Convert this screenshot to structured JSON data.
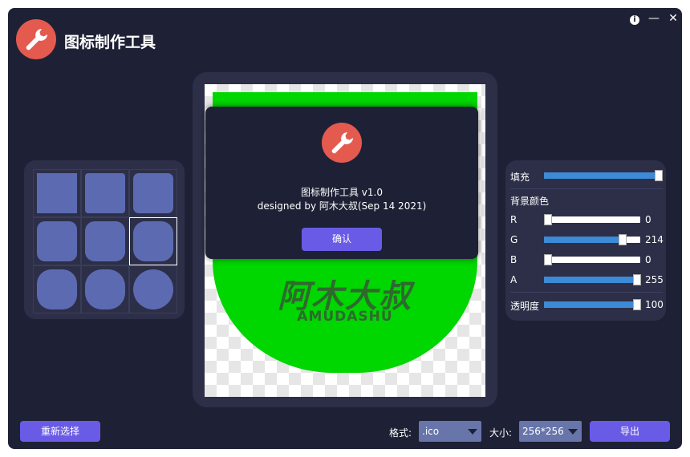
{
  "app": {
    "title": "图标制作工具",
    "logo_icon": "wrench-icon",
    "logo_color": "#e45a4f",
    "window_bg": "#1e2135",
    "accent": "#6a5be6"
  },
  "window_controls": {
    "info_icon": "info-icon",
    "info_glyph": "i",
    "minimize_glyph": "—",
    "close_glyph": "✕"
  },
  "shape_grid": {
    "selected_index": 5,
    "shapes": [
      "square",
      "rounded-small",
      "rounded-medium",
      "rounded-large",
      "rounded-larger",
      "rounded-xl",
      "squircle",
      "squircle-2",
      "circle"
    ],
    "shape_color": "#5c6bb1"
  },
  "preview": {
    "icon_color": "#00d600",
    "icon_text_cn": "阿木大叔",
    "icon_text_en": "AMUDASHU"
  },
  "dialog": {
    "line1": "图标制作工具 v1.0",
    "line2": "designed by 阿木大叔(Sep 14 2021)",
    "confirm_label": "确认"
  },
  "controls": {
    "fill_label": "填充",
    "fill_value": 1.0,
    "bg_color_label": "背景颜色",
    "r_label": "R",
    "r_value": "0",
    "g_label": "G",
    "g_value": "214",
    "b_label": "B",
    "b_value": "0",
    "a_label": "A",
    "a_value": "255",
    "opacity_label": "透明度",
    "opacity_value": "100"
  },
  "bottom": {
    "reselect_label": "重新选择",
    "format_label": "格式:",
    "format_value": ".ico",
    "size_label": "大小:",
    "size_value": "256*256",
    "export_label": "导出"
  }
}
